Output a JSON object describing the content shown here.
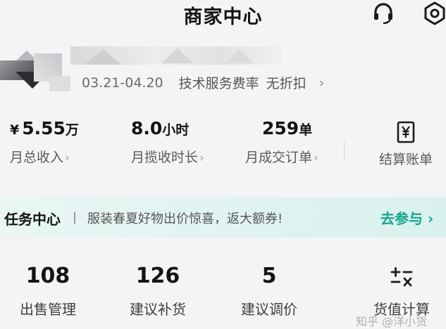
{
  "header": {
    "title": "商家中心",
    "support_icon": "headset-icon",
    "settings_icon": "gear-icon"
  },
  "shop": {
    "name_blurred": true,
    "period": "03.21-04.20",
    "fee_label": "技术服务费率",
    "fee_value": "无折扣",
    "chevron": "›"
  },
  "stats": [
    {
      "prefix": "¥",
      "value": "5.55",
      "unit": "万",
      "label": "月总收入"
    },
    {
      "value": "8.0",
      "unit": "小时",
      "label": "月揽收时长"
    },
    {
      "value": "259",
      "unit": "单",
      "label": "月成交订单"
    }
  ],
  "bill": {
    "icon": "yen-document-icon",
    "label": "结算账单"
  },
  "task": {
    "title": "任务中心",
    "desc": "服装春夏好物出价惊喜，返大额券!",
    "cta": "去参与 ›"
  },
  "stats2": [
    {
      "value": "108",
      "label": "出售管理"
    },
    {
      "value": "126",
      "label": "建议补货"
    },
    {
      "value": "5",
      "label": "建议调价"
    }
  ],
  "calc": {
    "icon": "calculator-icon",
    "label": "货值计算"
  },
  "watermark": "知乎 @洋小货",
  "colors": {
    "accent": "#17a392",
    "task_bg": "#dff3f0",
    "background": "#f4f4f6"
  }
}
